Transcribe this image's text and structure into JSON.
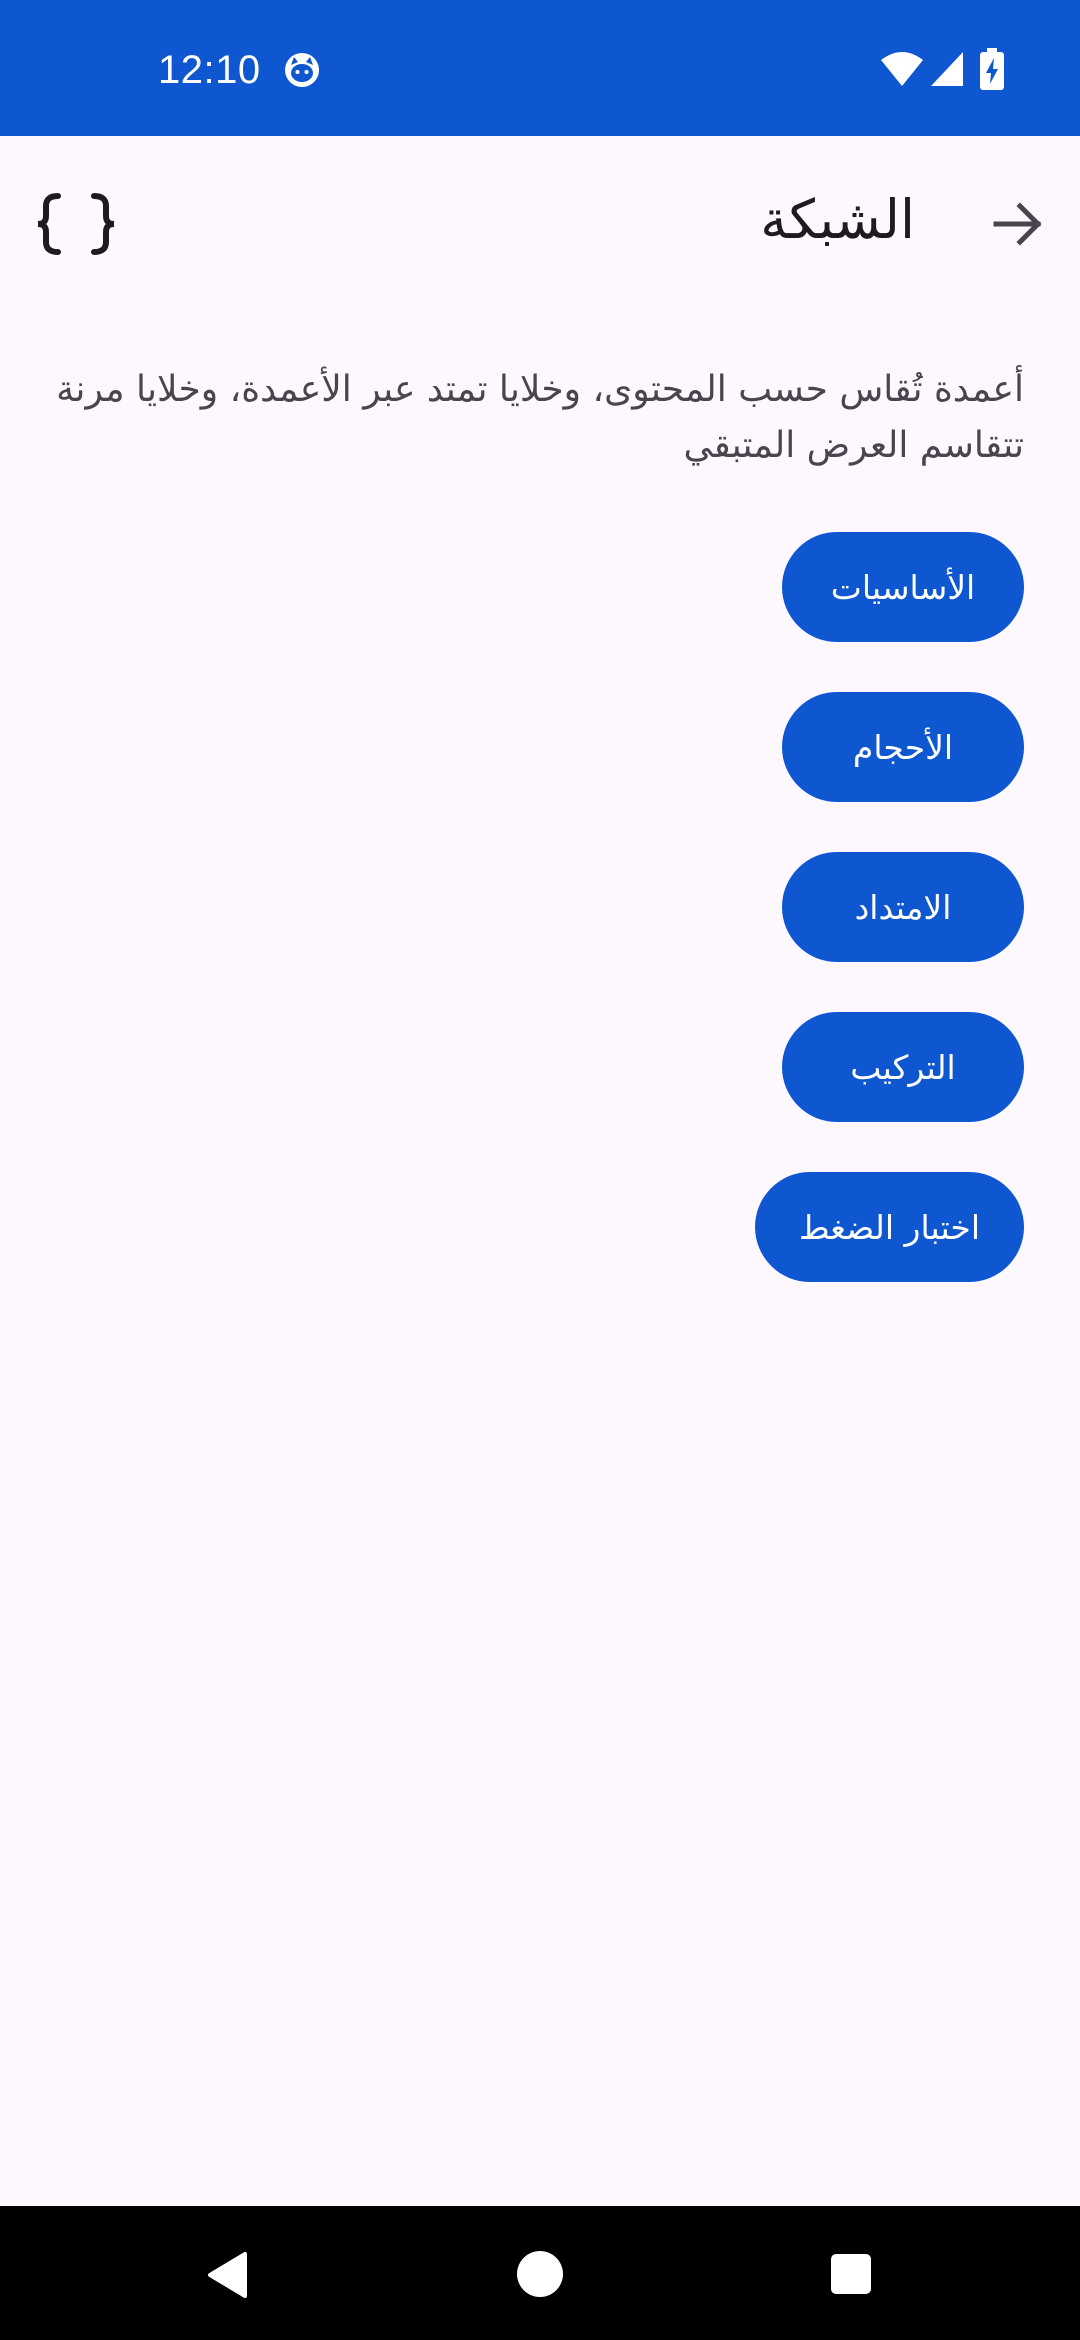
{
  "status_bar": {
    "time": "12:10",
    "background_color": "#0e57d1",
    "icons": [
      "cat-face-icon",
      "wifi-icon",
      "signal-icon",
      "battery-charging-icon"
    ]
  },
  "app_bar": {
    "title": "الشبكة",
    "back_icon": "arrow-icon",
    "action_icon": "code-braces-icon"
  },
  "content": {
    "description": "أعمدة تُقاس حسب المحتوى، وخلايا تمتد عبر الأعمدة، وخلايا مرنة تتقاسم العرض المتبقي",
    "buttons": [
      {
        "label": "الأساسيات"
      },
      {
        "label": "الأحجام"
      },
      {
        "label": "الامتداد"
      },
      {
        "label": "التركيب"
      },
      {
        "label": "اختبار الضغط"
      }
    ],
    "button_color": "#0e57d1"
  },
  "nav_bar": {
    "icons": [
      "nav-back-icon",
      "nav-home-icon",
      "nav-recents-icon"
    ]
  }
}
